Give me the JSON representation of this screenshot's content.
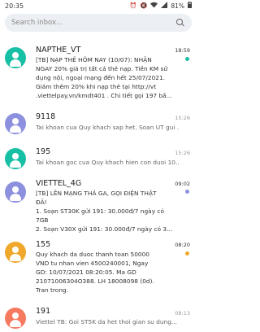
{
  "status_bar": {
    "time": "20:35",
    "icons": [
      "alarm-icon",
      "mute-icon",
      "wifi-icon",
      "signal-icon",
      "battery-icon"
    ],
    "battery": "81%"
  },
  "search": {
    "placeholder": "Search inbox..."
  },
  "conversations": [
    {
      "sender": "NAPTHE_VT",
      "time": "18:59",
      "avatar_color": "#17bfa5",
      "unread": true,
      "dot_color": "#17bfa5",
      "preview_lines": [
        "[TB] NẠP THẺ HÔM NAY (10/07): NHẬN",
        "NGAY 20% giá trị tất cả thẻ nạp. Tiền KM sử",
        "dụng nội, ngoại mạng đến hết 25/07/2021.",
        "Giảm thêm 20% khi nạp thẻ tại http://vt",
        ".viettelpay.vn/kmdt401 . Chi tiết gọi 197 bấ..."
      ]
    },
    {
      "sender": "9118",
      "time": "15:26",
      "avatar_color": "#8c90de",
      "unread": false,
      "preview_lines": [
        "Tai khoan cua Quy khach sap het. Soan UT gui ..."
      ]
    },
    {
      "sender": "195",
      "time": "15:26",
      "avatar_color": "#17bfa5",
      "unread": false,
      "preview_lines": [
        "Tai khoan goc cua Quy khach hien con duoi 10..."
      ]
    },
    {
      "sender": "VIETTEL_4G",
      "time": "09:02",
      "avatar_color": "#8c90de",
      "unread": true,
      "dot_color": "#8c90de",
      "preview_lines": [
        "[TB] LÊN MẠNG THẢ GA, GỌI ĐIỆN THẬT",
        "ĐÃ!",
        "1. Soạn ST30K gửi 191: 30.000đ/7 ngày có",
        "7GB",
        "2. Soạn V30X gửi 191: 30.000đ/7 ngày có 3..."
      ]
    },
    {
      "sender": "155",
      "time": "08:20",
      "avatar_color": "#f0a82c",
      "unread": true,
      "dot_color": "#f0a82c",
      "preview_lines": [
        "Quy khach da duoc thanh toan 50000",
        "VND tu nhan vien 4500240001, Ngay",
        "GD: 10/07/2021 08:20:05. Ma GD",
        "21071006304O388. LH 18008098 (0d).",
        "Tran trong."
      ]
    },
    {
      "sender": "191",
      "time": "08:13",
      "avatar_color": "#f57a5f",
      "unread": false,
      "preview_lines": [
        "Viettel TB: Goi ST5K da het thoi gian su dung..."
      ]
    }
  ]
}
